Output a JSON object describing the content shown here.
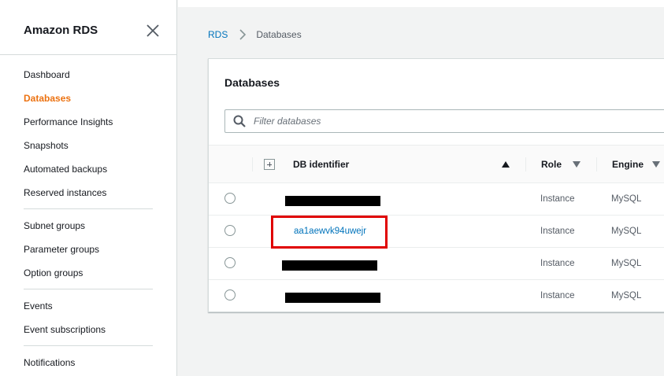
{
  "sidebar": {
    "title": "Amazon RDS",
    "groups": [
      [
        {
          "label": "Dashboard",
          "active": false
        },
        {
          "label": "Databases",
          "active": true
        },
        {
          "label": "Performance Insights",
          "active": false
        },
        {
          "label": "Snapshots",
          "active": false
        },
        {
          "label": "Automated backups",
          "active": false
        },
        {
          "label": "Reserved instances",
          "active": false
        }
      ],
      [
        {
          "label": "Subnet groups",
          "active": false
        },
        {
          "label": "Parameter groups",
          "active": false
        },
        {
          "label": "Option groups",
          "active": false
        }
      ],
      [
        {
          "label": "Events",
          "active": false
        },
        {
          "label": "Event subscriptions",
          "active": false
        }
      ],
      [
        {
          "label": "Notifications",
          "active": false
        }
      ]
    ]
  },
  "breadcrumb": {
    "root": "RDS",
    "current": "Databases"
  },
  "panel": {
    "title": "Databases",
    "filter_placeholder": "Filter databases"
  },
  "table": {
    "columns": {
      "identifier": "DB identifier",
      "role": "Role",
      "engine": "Engine"
    },
    "rows": [
      {
        "identifier": "",
        "redacted": true,
        "role": "Instance",
        "engine": "MySQL"
      },
      {
        "identifier": "aa1aewvk94uwejr",
        "redacted": false,
        "highlighted": true,
        "role": "Instance",
        "engine": "MySQL"
      },
      {
        "identifier": "",
        "redacted": true,
        "role": "Instance",
        "engine": "MySQL"
      },
      {
        "identifier": "",
        "redacted": true,
        "role": "Instance",
        "engine": "MySQL"
      }
    ]
  },
  "colors": {
    "accent": "#ec7211",
    "link": "#0073bb",
    "highlight": "#e00000"
  },
  "icons": [
    "close-icon",
    "chevron-right-icon",
    "search-icon",
    "expand-icon",
    "sort-ascending-icon",
    "sort-descending-icon"
  ]
}
